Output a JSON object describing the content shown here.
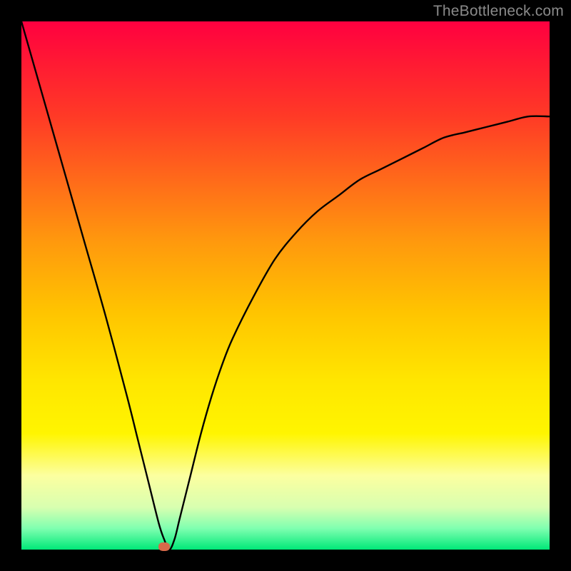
{
  "watermark": "TheBottleneck.com",
  "chart_data": {
    "type": "line",
    "title": "",
    "xlabel": "",
    "ylabel": "",
    "xlim": [
      0,
      100
    ],
    "ylim": [
      0,
      100
    ],
    "grid": false,
    "legend": false,
    "series": [
      {
        "name": "curve",
        "x": [
          0,
          4,
          8,
          12,
          16,
          20,
          22,
          24,
          26,
          27,
          28,
          29,
          30,
          32,
          34,
          36,
          38,
          40,
          44,
          48,
          52,
          56,
          60,
          64,
          68,
          72,
          76,
          80,
          84,
          88,
          92,
          96,
          100
        ],
        "values": [
          100,
          86,
          72,
          58,
          44,
          29,
          21,
          13,
          5,
          2,
          0,
          2,
          6,
          14,
          22,
          29,
          35,
          40,
          48,
          55,
          60,
          64,
          67,
          70,
          72,
          74,
          76,
          78,
          79,
          80,
          81,
          82,
          82
        ]
      }
    ],
    "marker": {
      "x": 27,
      "y": 0.5,
      "color": "#d86a4a"
    },
    "background_gradient": {
      "direction": "vertical",
      "stops": [
        {
          "pos": 0.0,
          "color": "#ff0040"
        },
        {
          "pos": 0.3,
          "color": "#ff6a1a"
        },
        {
          "pos": 0.55,
          "color": "#ffc400"
        },
        {
          "pos": 0.78,
          "color": "#fff500"
        },
        {
          "pos": 0.92,
          "color": "#d8ffb0"
        },
        {
          "pos": 1.0,
          "color": "#00e878"
        }
      ]
    }
  }
}
